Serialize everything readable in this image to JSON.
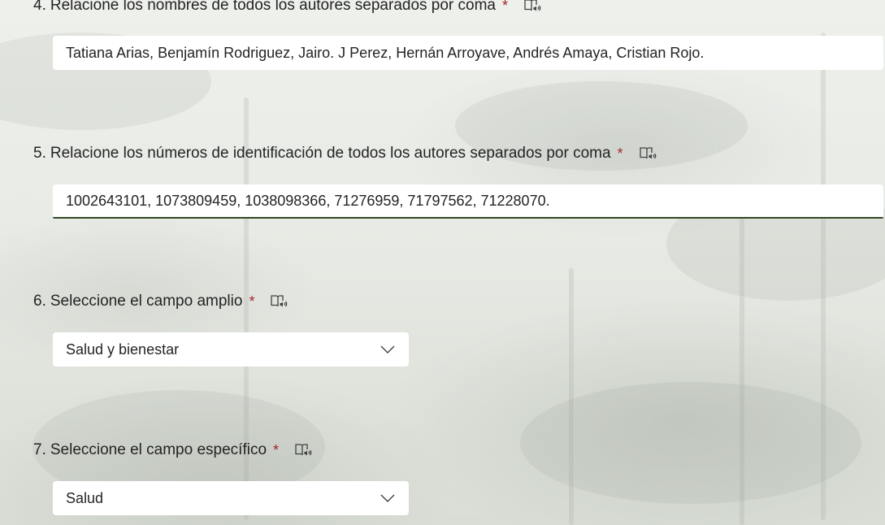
{
  "questions": [
    {
      "number": "4.",
      "label": "Relacione los nombres de todos los autores separados por coma",
      "required_mark": "*",
      "answer": "Tatiana Arias, Benjamín Rodriguez, Jairo. J Perez, Hernán Arroyave, Andrés Amaya, Cristian Rojo."
    },
    {
      "number": "5.",
      "label": "Relacione los números de identificación de todos los autores separados por coma",
      "required_mark": "*",
      "answer": "1002643101, 1073809459, 1038098366, 71276959,  71797562,  71228070."
    },
    {
      "number": "6.",
      "label": "Seleccione el campo amplio",
      "required_mark": "*",
      "selected": "Salud y bienestar"
    },
    {
      "number": "7.",
      "label": "Seleccione el campo específico",
      "required_mark": "*",
      "selected": "Salud"
    }
  ],
  "icons": {
    "reader": "immersive-reader-icon",
    "dropdown": "chevron-down-icon"
  },
  "colors": {
    "required": "#a4262c",
    "focus_underline": "#2f4a1f",
    "text": "#242424"
  }
}
